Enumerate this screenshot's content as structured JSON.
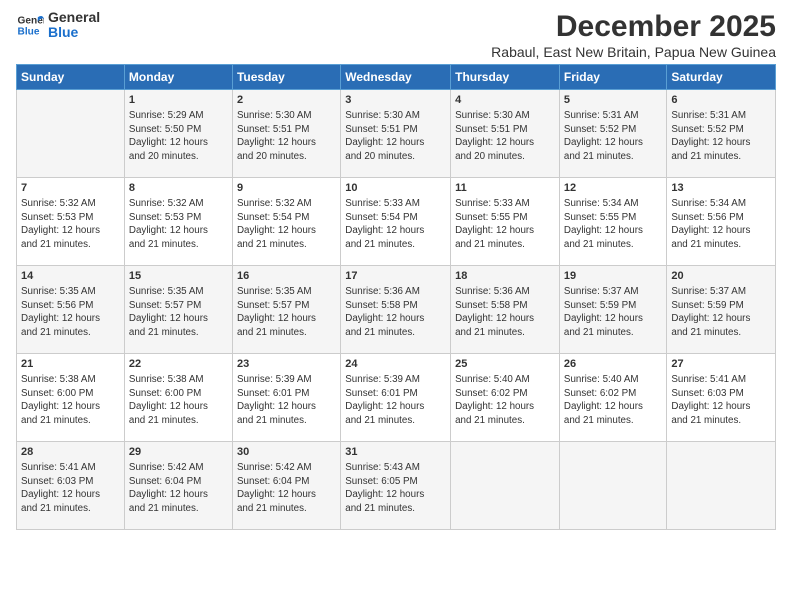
{
  "logo": {
    "line1": "General",
    "line2": "Blue"
  },
  "title": "December 2025",
  "subtitle": "Rabaul, East New Britain, Papua New Guinea",
  "header_days": [
    "Sunday",
    "Monday",
    "Tuesday",
    "Wednesday",
    "Thursday",
    "Friday",
    "Saturday"
  ],
  "weeks": [
    [
      {
        "day": "",
        "content": ""
      },
      {
        "day": "1",
        "content": "Sunrise: 5:29 AM\nSunset: 5:50 PM\nDaylight: 12 hours\nand 20 minutes."
      },
      {
        "day": "2",
        "content": "Sunrise: 5:30 AM\nSunset: 5:51 PM\nDaylight: 12 hours\nand 20 minutes."
      },
      {
        "day": "3",
        "content": "Sunrise: 5:30 AM\nSunset: 5:51 PM\nDaylight: 12 hours\nand 20 minutes."
      },
      {
        "day": "4",
        "content": "Sunrise: 5:30 AM\nSunset: 5:51 PM\nDaylight: 12 hours\nand 20 minutes."
      },
      {
        "day": "5",
        "content": "Sunrise: 5:31 AM\nSunset: 5:52 PM\nDaylight: 12 hours\nand 21 minutes."
      },
      {
        "day": "6",
        "content": "Sunrise: 5:31 AM\nSunset: 5:52 PM\nDaylight: 12 hours\nand 21 minutes."
      }
    ],
    [
      {
        "day": "7",
        "content": "Sunrise: 5:32 AM\nSunset: 5:53 PM\nDaylight: 12 hours\nand 21 minutes."
      },
      {
        "day": "8",
        "content": "Sunrise: 5:32 AM\nSunset: 5:53 PM\nDaylight: 12 hours\nand 21 minutes."
      },
      {
        "day": "9",
        "content": "Sunrise: 5:32 AM\nSunset: 5:54 PM\nDaylight: 12 hours\nand 21 minutes."
      },
      {
        "day": "10",
        "content": "Sunrise: 5:33 AM\nSunset: 5:54 PM\nDaylight: 12 hours\nand 21 minutes."
      },
      {
        "day": "11",
        "content": "Sunrise: 5:33 AM\nSunset: 5:55 PM\nDaylight: 12 hours\nand 21 minutes."
      },
      {
        "day": "12",
        "content": "Sunrise: 5:34 AM\nSunset: 5:55 PM\nDaylight: 12 hours\nand 21 minutes."
      },
      {
        "day": "13",
        "content": "Sunrise: 5:34 AM\nSunset: 5:56 PM\nDaylight: 12 hours\nand 21 minutes."
      }
    ],
    [
      {
        "day": "14",
        "content": "Sunrise: 5:35 AM\nSunset: 5:56 PM\nDaylight: 12 hours\nand 21 minutes."
      },
      {
        "day": "15",
        "content": "Sunrise: 5:35 AM\nSunset: 5:57 PM\nDaylight: 12 hours\nand 21 minutes."
      },
      {
        "day": "16",
        "content": "Sunrise: 5:35 AM\nSunset: 5:57 PM\nDaylight: 12 hours\nand 21 minutes."
      },
      {
        "day": "17",
        "content": "Sunrise: 5:36 AM\nSunset: 5:58 PM\nDaylight: 12 hours\nand 21 minutes."
      },
      {
        "day": "18",
        "content": "Sunrise: 5:36 AM\nSunset: 5:58 PM\nDaylight: 12 hours\nand 21 minutes."
      },
      {
        "day": "19",
        "content": "Sunrise: 5:37 AM\nSunset: 5:59 PM\nDaylight: 12 hours\nand 21 minutes."
      },
      {
        "day": "20",
        "content": "Sunrise: 5:37 AM\nSunset: 5:59 PM\nDaylight: 12 hours\nand 21 minutes."
      }
    ],
    [
      {
        "day": "21",
        "content": "Sunrise: 5:38 AM\nSunset: 6:00 PM\nDaylight: 12 hours\nand 21 minutes."
      },
      {
        "day": "22",
        "content": "Sunrise: 5:38 AM\nSunset: 6:00 PM\nDaylight: 12 hours\nand 21 minutes."
      },
      {
        "day": "23",
        "content": "Sunrise: 5:39 AM\nSunset: 6:01 PM\nDaylight: 12 hours\nand 21 minutes."
      },
      {
        "day": "24",
        "content": "Sunrise: 5:39 AM\nSunset: 6:01 PM\nDaylight: 12 hours\nand 21 minutes."
      },
      {
        "day": "25",
        "content": "Sunrise: 5:40 AM\nSunset: 6:02 PM\nDaylight: 12 hours\nand 21 minutes."
      },
      {
        "day": "26",
        "content": "Sunrise: 5:40 AM\nSunset: 6:02 PM\nDaylight: 12 hours\nand 21 minutes."
      },
      {
        "day": "27",
        "content": "Sunrise: 5:41 AM\nSunset: 6:03 PM\nDaylight: 12 hours\nand 21 minutes."
      }
    ],
    [
      {
        "day": "28",
        "content": "Sunrise: 5:41 AM\nSunset: 6:03 PM\nDaylight: 12 hours\nand 21 minutes."
      },
      {
        "day": "29",
        "content": "Sunrise: 5:42 AM\nSunset: 6:04 PM\nDaylight: 12 hours\nand 21 minutes."
      },
      {
        "day": "30",
        "content": "Sunrise: 5:42 AM\nSunset: 6:04 PM\nDaylight: 12 hours\nand 21 minutes."
      },
      {
        "day": "31",
        "content": "Sunrise: 5:43 AM\nSunset: 6:05 PM\nDaylight: 12 hours\nand 21 minutes."
      },
      {
        "day": "",
        "content": ""
      },
      {
        "day": "",
        "content": ""
      },
      {
        "day": "",
        "content": ""
      }
    ]
  ]
}
